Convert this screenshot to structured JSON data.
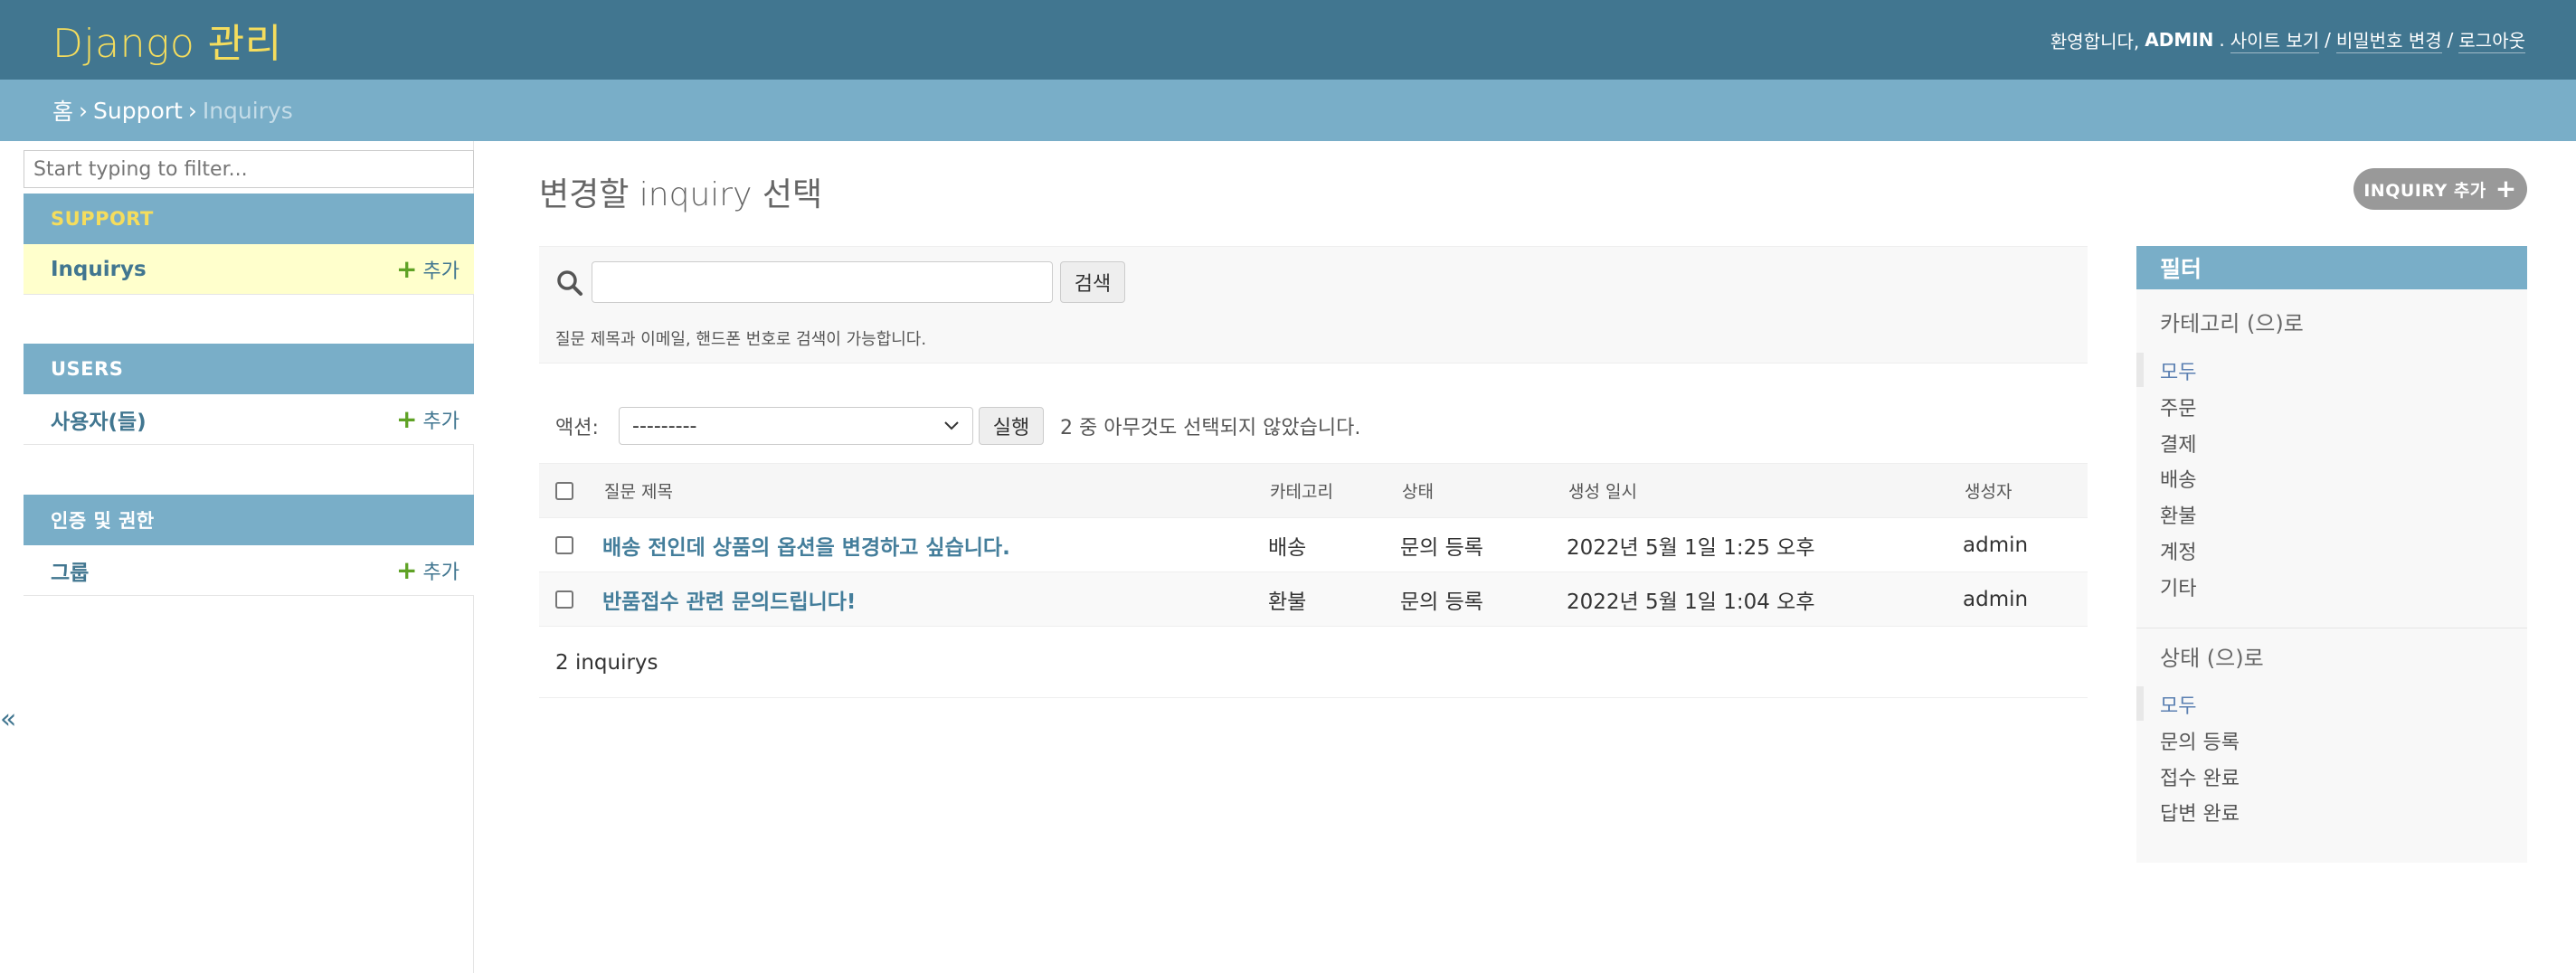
{
  "header": {
    "branding": "Django 관리",
    "welcome": "환영합니다,",
    "username": "ADMIN",
    "view_site": "사이트 보기",
    "change_password": "비밀번호 변경",
    "logout": "로그아웃",
    "separator": "/"
  },
  "breadcrumbs": {
    "home": "홈",
    "app": "Support",
    "current": "Inquirys",
    "sep": "›"
  },
  "sidebar": {
    "filter_placeholder": "Start typing to filter...",
    "add_label": "추가",
    "modules": [
      {
        "name": "SUPPORT",
        "models": [
          "Inquirys"
        ]
      },
      {
        "name": "USERS",
        "models": [
          "사용자(들)"
        ]
      },
      {
        "name": "인증 및 권한",
        "models": [
          "그룹"
        ]
      }
    ],
    "toggle": "«"
  },
  "main": {
    "title": "변경할 inquiry 선택",
    "add_button": "INQUIRY 추가",
    "search_button": "검색",
    "search_help": "질문 제목과 이메일, 핸드폰 번호로 검색이 가능합니다.",
    "action_label": "액션:",
    "action_default": "---------",
    "go_button": "실행",
    "action_counter": "2 중 아무것도 선택되지 않았습니다.",
    "columns": [
      "질문 제목",
      "카테고리",
      "상태",
      "생성 일시",
      "생성자"
    ],
    "rows": [
      [
        "배송 전인데 상품의 옵션을 변경하고 싶습니다.",
        "배송",
        "문의 등록",
        "2022년 5월 1일 1:25 오후",
        "admin"
      ],
      [
        "반품접수 관련 문의드립니다!",
        "환불",
        "문의 등록",
        "2022년 5월 1일 1:04 오후",
        "admin"
      ]
    ],
    "paginator": "2 inquirys"
  },
  "filter": {
    "title": "필터",
    "groups": [
      {
        "title": "카테고리 (으)로",
        "items": [
          "모두",
          "주문",
          "결제",
          "배송",
          "환불",
          "계정",
          "기타"
        ],
        "selected": "모두"
      },
      {
        "title": "상태 (으)로",
        "items": [
          "모두",
          "문의 등록",
          "접수 완료",
          "답변 완료"
        ],
        "selected": "모두"
      }
    ]
  },
  "colors": {
    "header_bg": "#417690",
    "breadcrumb_bg": "#79aec8",
    "branding": "#f5dd5d",
    "link": "#447e9b",
    "add_green": "#5fa225",
    "current_row": "#ffffcc"
  }
}
